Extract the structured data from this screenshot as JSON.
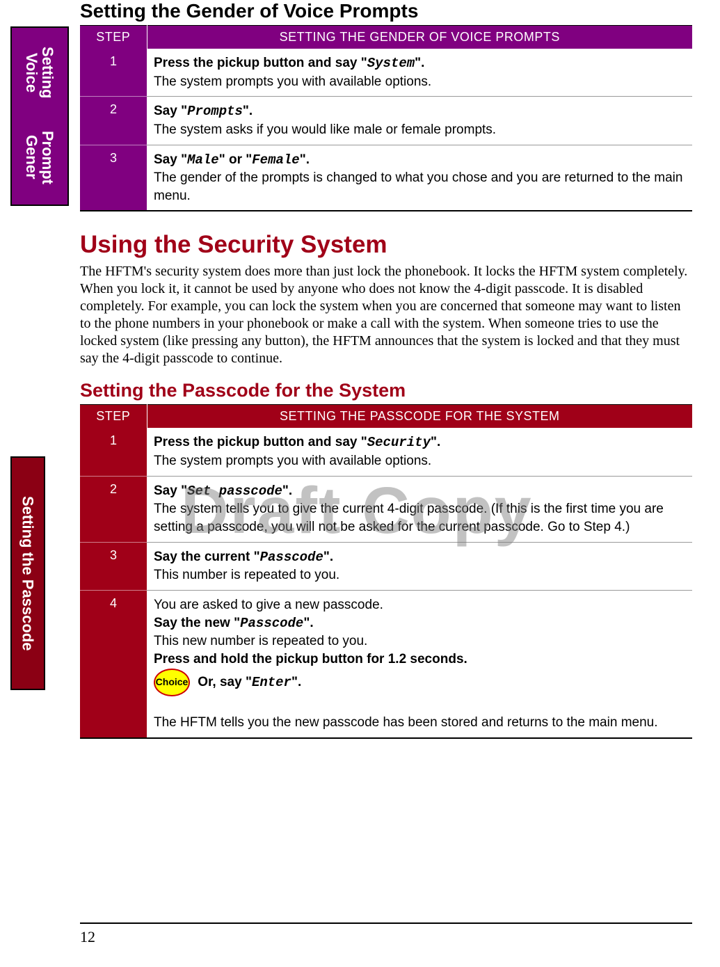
{
  "tabs": {
    "tab1_line1": "Setting Voice",
    "tab1_line2": "Prompt Gener",
    "tab2": "Setting the Passcode"
  },
  "section1": {
    "title": "Setting the Gender of Voice Prompts",
    "col_step": "STEP",
    "col_desc": "SETTING THE GENDER OF VOICE PROMPTS",
    "rows": [
      {
        "n": "1",
        "lead_pre": "Press the pickup button and say \"",
        "cmd": "System",
        "lead_post": "\".",
        "body": "The system prompts you with available options."
      },
      {
        "n": "2",
        "lead_pre": "Say \"",
        "cmd": "Prompts",
        "lead_post": "\".",
        "body": "The system asks if you would like male or female prompts."
      },
      {
        "n": "3",
        "lead_pre": "Say \"",
        "cmd": "Male",
        "mid": "\" or \"",
        "cmd2": "Female",
        "lead_post": "\".",
        "body": "The gender of the prompts is changed to what you chose and you are returned to the main menu."
      }
    ]
  },
  "section2": {
    "title": "Using the Security System",
    "para": "The HFTM's security system does more than just lock the phonebook. It locks the HFTM system completely. When you lock it, it cannot be used by anyone who does not know the 4-digit passcode. It is disabled completely. For example, you can lock the system when you are concerned that someone may want to listen to the phone numbers in your phonebook or make a call with the system. When someone tries to use the locked system (like pressing any button), the HFTM announces that the system is locked and that they must say the 4-digit passcode to continue."
  },
  "section3": {
    "title": "Setting the Passcode for the System",
    "col_step": "STEP",
    "col_desc": "SETTING THE PASSCODE FOR THE SYSTEM",
    "rows": [
      {
        "n": "1",
        "lead_pre": "Press the pickup button and say \"",
        "cmd": "Security",
        "lead_post": "\".",
        "body": "The system prompts you with available options."
      },
      {
        "n": "2",
        "lead_pre": "Say \"",
        "cmd": "Set passcode",
        "lead_post": "\".",
        "body": "The system tells you to give the current 4-digit passcode. (If this is the first time you are setting a passcode, you will not be asked for the current passcode. Go to Step 4.)"
      },
      {
        "n": "3",
        "lead_pre": "Say the current \"",
        "cmd": "Passcode",
        "lead_post": "\".",
        "body": "This number is repeated to you."
      },
      {
        "n": "4",
        "pre_body": "You are asked to give a new passcode.",
        "lead_pre": "Say the new \"",
        "cmd": "Passcode",
        "lead_post": "\".",
        "mid_body": "This new number is repeated to you.",
        "bold2": "Press and hold the pickup button for 1.2 seconds.",
        "choice_label": "Choice",
        "or_pre": " Or, say \"",
        "or_cmd": "Enter",
        "or_post": "\".",
        "final": "The HFTM tells you the new passcode has been stored and returns to the main menu."
      }
    ]
  },
  "watermark": "Draft Copy",
  "page_number": "12"
}
